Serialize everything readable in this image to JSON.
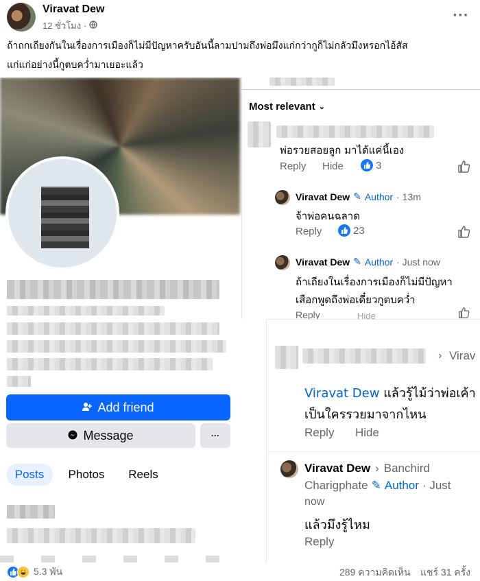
{
  "post": {
    "author": "Viravat Dew",
    "time": "12 ชั่วโมง",
    "privacy_separator": "·",
    "more": "···",
    "text": "ถ้าถกเถียงกันในเรื่องการเมืองก็ไม่มีปัญหาครับอันนี้ลามปามถึงพ่อมึงแก่กว่ากูก็ไม่กลัวมึงหรอกไอ้สัส\nแก่แก่อย่างนี้กูตบคว่ำมาเยอะแล้ว"
  },
  "left_panel": {
    "add_friend": "Add friend",
    "message": "Message",
    "more": "···",
    "tabs": [
      "Posts",
      "Photos",
      "Reels"
    ]
  },
  "right_panel": {
    "sort_label": "Most relevant",
    "comment1": {
      "text": "พ่อรวยสอยลูก มาได้แค่นี้เอง",
      "reply": "Reply",
      "hide": "Hide",
      "likes": "3"
    },
    "reply1": {
      "name": "Viravat Dew",
      "author_badge": "Author",
      "time": "· 13m",
      "text": "จ้าพ่อคนฉลาด",
      "reply": "Reply",
      "likes": "23"
    },
    "reply2": {
      "name": "Viravat Dew",
      "author_badge": "Author",
      "time": "· Just now",
      "text_line1": "ถ้าเถียงในเรื่องการเมืองก็ไม่มีปัญหา",
      "text_line2": "เสือกพูดถึงพ่อเดี๋ยวกูตบคว่ำ",
      "reply": "Reply",
      "hide_partial": "Hide"
    }
  },
  "lower_right": {
    "header_partial": "Virav",
    "comment": {
      "mention": "Viravat Dew",
      "text_after_mention": " แล้วรู้ไม้ว่าพ่อเค้า",
      "text_line2": "เป็นใครรวยมาจากไหน",
      "reply": "Reply",
      "hide": "Hide"
    },
    "reply": {
      "name": "Viravat Dew",
      "to_line1": "Banchird",
      "to_line2": "Charigphate",
      "author_badge": "Author",
      "time_line1": "· Just",
      "time_line2": "now",
      "text": "แล้วมึงรู้ไหม",
      "reply": "Reply"
    }
  },
  "footer": {
    "reaction_count": "5.3 พัน",
    "comments": "289 ความคิดเห็น",
    "shares": "แชร์ 31 ครั้ง"
  },
  "colors": {
    "fb_blue": "#0866ff",
    "link_blue": "#0064d1",
    "secondary_text": "#65676b",
    "button_gray": "#e4e6eb"
  }
}
